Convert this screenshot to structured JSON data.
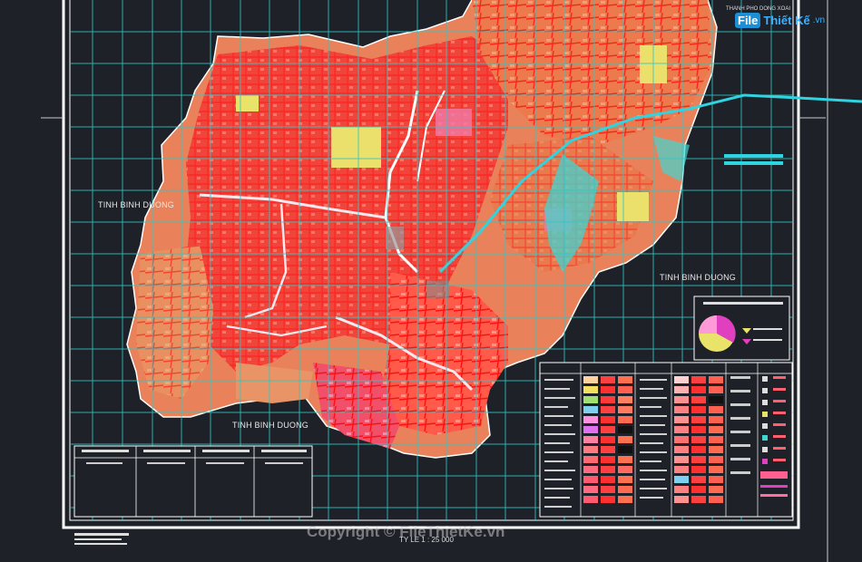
{
  "map": {
    "labels": {
      "binh_duong_west": "TINH BINH DUONG",
      "binh_duong_east": "TINH BINH DUONG",
      "binh_duong_south": "TINH BINH DUONG",
      "top_city": "THANH PHO DONG XOAI"
    },
    "scale_text": "TY LE 1 : 25 000",
    "watermark": "Copyright © FileThietKe.vn"
  },
  "logo": {
    "box": "File",
    "text": "Thiết Kế",
    "domain": ".vn"
  },
  "colors": {
    "background": "#1e2128",
    "frame": "#ffffff",
    "grid": "#2fc7c7",
    "urban": "#f0453a",
    "residential": "#e8895c",
    "roads": "#ff1a1a",
    "green": "#e9e36a",
    "water": "#41d6d0",
    "highway": "#2fd4e0"
  }
}
